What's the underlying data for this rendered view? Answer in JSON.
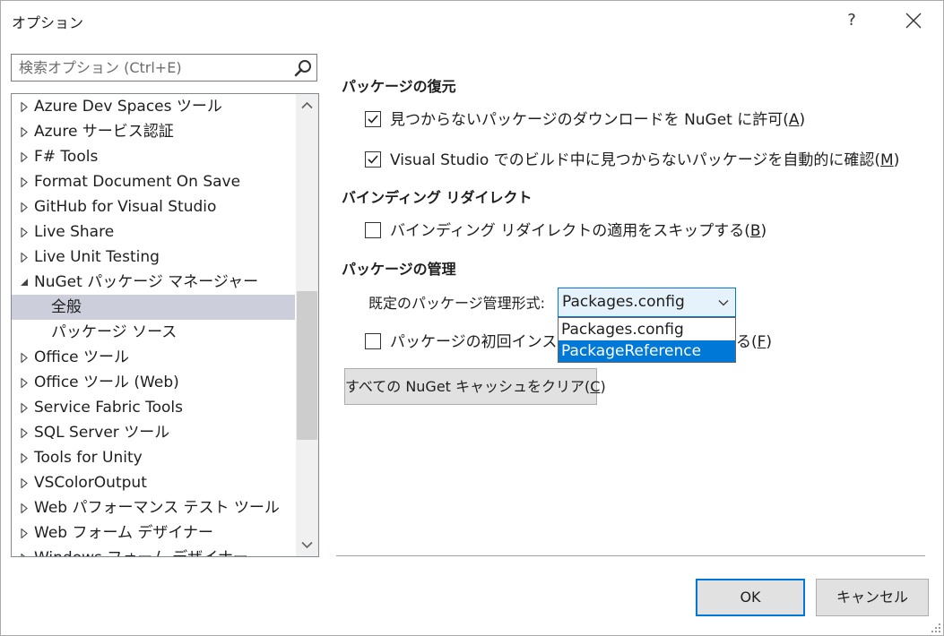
{
  "window": {
    "title": "オプション",
    "help_label": "?"
  },
  "search": {
    "placeholder": "検索オプション (Ctrl+E)"
  },
  "tree": {
    "items": [
      {
        "label": "Azure Dev Spaces ツール",
        "expanded": false
      },
      {
        "label": "Azure サービス認証",
        "expanded": false
      },
      {
        "label": "F# Tools",
        "expanded": false
      },
      {
        "label": "Format Document On Save",
        "expanded": false
      },
      {
        "label": "GitHub for Visual Studio",
        "expanded": false
      },
      {
        "label": "Live Share",
        "expanded": false
      },
      {
        "label": "Live Unit Testing",
        "expanded": false
      },
      {
        "label": "NuGet パッケージ マネージャー",
        "expanded": true
      },
      {
        "label": "全般",
        "child": true,
        "selected": true
      },
      {
        "label": "パッケージ ソース",
        "child": true
      },
      {
        "label": "Office ツール",
        "expanded": false
      },
      {
        "label": "Office ツール (Web)",
        "expanded": false
      },
      {
        "label": "Service Fabric Tools",
        "expanded": false
      },
      {
        "label": "SQL Server ツール",
        "expanded": false
      },
      {
        "label": "Tools for Unity",
        "expanded": false
      },
      {
        "label": "VSColorOutput",
        "expanded": false
      },
      {
        "label": "Web パフォーマンス テスト ツール",
        "expanded": false
      },
      {
        "label": "Web フォーム デザイナー",
        "expanded": false
      },
      {
        "label": "Windows フォーム デザイナー",
        "expanded": false
      }
    ]
  },
  "restore": {
    "header": "パッケージの復元",
    "allow_download": {
      "label": "見つからないパッケージのダウンロードを NuGet に許可",
      "mnemonic": "A",
      "checked": true
    },
    "auto_check": {
      "label": "Visual Studio でのビルド中に見つからないパッケージを自動的に確認",
      "mnemonic": "M",
      "checked": true
    }
  },
  "binding": {
    "header": "バインディング リダイレクト",
    "skip": {
      "label": "バインディング リダイレクトの適用をスキップする",
      "mnemonic": "B",
      "checked": false
    }
  },
  "management": {
    "header": "パッケージの管理",
    "format_label": "既定のパッケージ管理形式:",
    "format_selected": "Packages.config",
    "format_options": [
      "Packages.config",
      "PackageReference"
    ],
    "first_install": {
      "label": "パッケージの初回インストール",
      "suffix": "る",
      "mnemonic": "F",
      "checked": false
    },
    "clear_cache": {
      "label": "すべての NuGet キャッシュをクリア",
      "mnemonic": "C"
    }
  },
  "footer": {
    "ok_label": "OK",
    "cancel_label": "キャンセル"
  },
  "colors": {
    "accent": "#0078d7",
    "selection": "#cccedb",
    "button_face": "#e1e1e1"
  }
}
